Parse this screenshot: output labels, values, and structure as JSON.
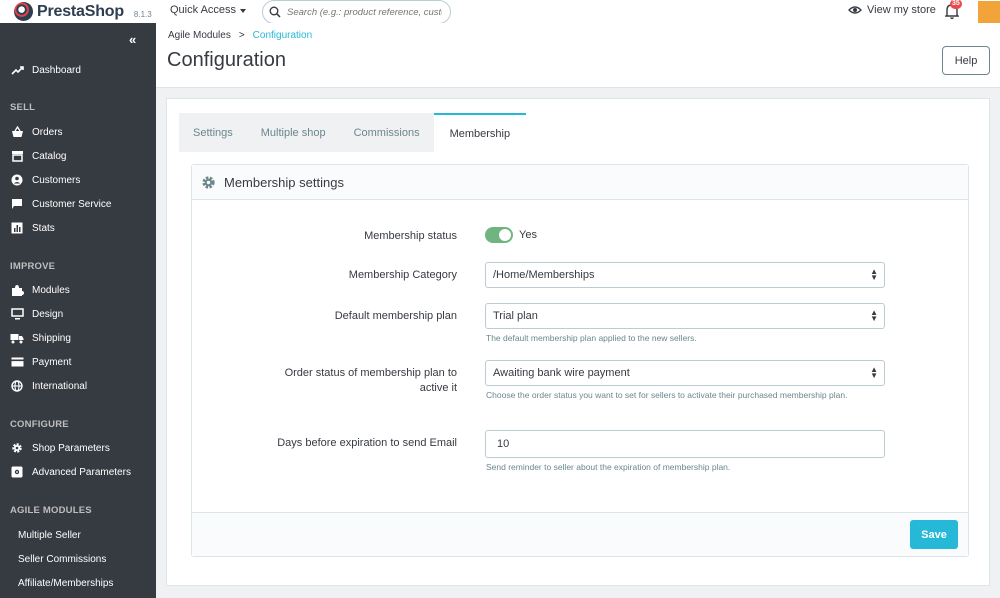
{
  "header": {
    "brand": "PrestaShop",
    "version": "8.1.3",
    "quick_access": "Quick Access",
    "search_placeholder": "Search (e.g.: product reference, custon",
    "view_store": "View my store",
    "notifications_count": "35"
  },
  "sidebar": {
    "collapse": "«",
    "dashboard": "Dashboard",
    "sections": {
      "sell": "SELL",
      "improve": "IMPROVE",
      "configure": "CONFIGURE",
      "agile": "AGILE MODULES"
    },
    "sell_items": [
      "Orders",
      "Catalog",
      "Customers",
      "Customer Service",
      "Stats"
    ],
    "improve_items": [
      "Modules",
      "Design",
      "Shipping",
      "Payment",
      "International"
    ],
    "configure_items": [
      "Shop Parameters",
      "Advanced Parameters"
    ],
    "agile_items": [
      "Multiple Seller",
      "Seller Commissions",
      "Affiliate/Memberships"
    ]
  },
  "page": {
    "breadcrumb_parent": "Agile Modules",
    "breadcrumb_sep": ">",
    "breadcrumb_current": "Configuration",
    "title": "Configuration",
    "help": "Help"
  },
  "tabs": [
    "Settings",
    "Multiple shop",
    "Commissions",
    "Membership"
  ],
  "panel": {
    "title": "Membership settings",
    "fields": {
      "status_label": "Membership status",
      "status_value": "Yes",
      "category_label": "Membership Category",
      "category_value": "/Home/Memberships",
      "plan_label": "Default membership plan",
      "plan_value": "Trial plan",
      "plan_help": "The default membership plan applied to the new sellers.",
      "order_status_label_1": "Order status of membership plan to",
      "order_status_label_2": "active it",
      "order_status_value": "Awaiting bank wire payment",
      "order_status_help": "Choose the order status you want to set for sellers to activate their purchased membership plan.",
      "days_label": "Days before expiration to send Email",
      "days_value": "10",
      "days_help": "Send reminder to seller about the expiration of membership plan."
    },
    "save": "Save"
  },
  "colors": {
    "accent": "#25b9d7",
    "sidebar": "#363a41",
    "switch_on": "#70b580"
  }
}
